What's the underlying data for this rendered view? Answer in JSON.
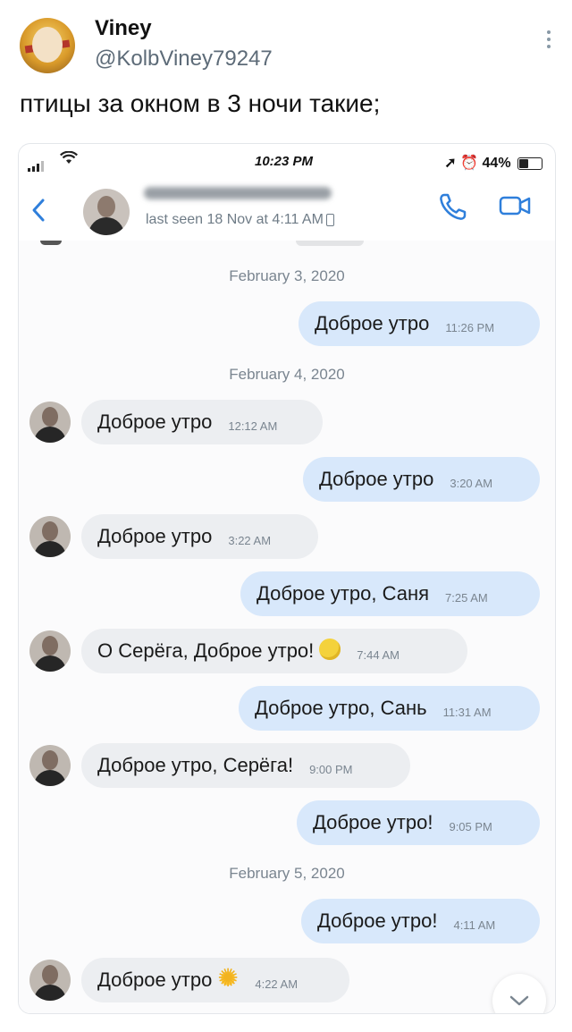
{
  "tweet": {
    "author_name": "Viney",
    "author_handle": "@KolbViney79247",
    "text": "птицы за окном в 3 ночи такие;"
  },
  "phone": {
    "status_bar": {
      "time": "10:23 PM",
      "battery": "44%"
    },
    "chat_header": {
      "last_seen": "last seen 18 Nov at 4:11 AM"
    },
    "messages": [
      {
        "type": "date",
        "text": "February 3, 2020"
      },
      {
        "type": "msg",
        "dir": "out",
        "text": "Доброе утро",
        "time": "11:26 PM"
      },
      {
        "type": "date",
        "text": "February 4, 2020"
      },
      {
        "type": "msg",
        "dir": "in",
        "text": "Доброе утро",
        "time": "12:12 AM"
      },
      {
        "type": "msg",
        "dir": "out",
        "text": "Доброе утро",
        "time": "3:20 AM"
      },
      {
        "type": "msg",
        "dir": "in",
        "text": "Доброе утро",
        "time": "3:22 AM"
      },
      {
        "type": "msg",
        "dir": "out",
        "text": "Доброе утро, Саня",
        "time": "7:25 AM"
      },
      {
        "type": "msg",
        "dir": "in",
        "text": "О Серёга, Доброе утро!",
        "time": "7:44 AM",
        "emoji": "face"
      },
      {
        "type": "msg",
        "dir": "out",
        "text": "Доброе утро, Сань",
        "time": "11:31 AM"
      },
      {
        "type": "msg",
        "dir": "in",
        "text": "Доброе утро, Серёга!",
        "time": "9:00 PM"
      },
      {
        "type": "msg",
        "dir": "out",
        "text": "Доброе утро!",
        "time": "9:05 PM"
      },
      {
        "type": "date",
        "text": "February 5, 2020"
      },
      {
        "type": "msg",
        "dir": "out",
        "text": "Доброе утро!",
        "time": "4:11 AM"
      },
      {
        "type": "msg",
        "dir": "in",
        "text": "Доброе утро",
        "time": "4:22 AM",
        "emoji": "sun"
      }
    ]
  }
}
